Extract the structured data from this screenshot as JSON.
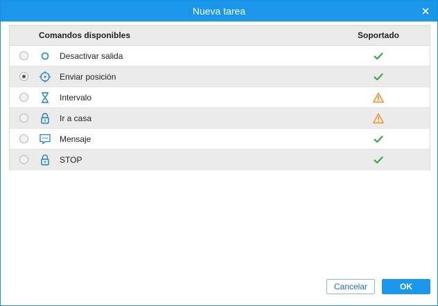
{
  "dialog": {
    "title": "Nueva tarea",
    "close_icon": "close-icon"
  },
  "table": {
    "columns": {
      "command": "Comandos disponibles",
      "supported": "Soportado"
    },
    "rows": [
      {
        "label": "Desactivar salida",
        "icon": "output-off-icon",
        "selected": false,
        "status": "check"
      },
      {
        "label": "Enviar posición",
        "icon": "crosshair-icon",
        "selected": true,
        "status": "check"
      },
      {
        "label": "Intervalo",
        "icon": "hourglass-icon",
        "selected": false,
        "status": "warning"
      },
      {
        "label": "Ir a casa",
        "icon": "lock-icon",
        "selected": false,
        "status": "warning"
      },
      {
        "label": "Mensaje",
        "icon": "message-icon",
        "selected": false,
        "status": "check"
      },
      {
        "label": "STOP",
        "icon": "lock-icon",
        "selected": false,
        "status": "check"
      }
    ]
  },
  "buttons": {
    "cancel": "Cancelar",
    "ok": "OK"
  },
  "colors": {
    "accent": "#1a97eb",
    "success": "#3aa649",
    "warning": "#f08a24"
  }
}
